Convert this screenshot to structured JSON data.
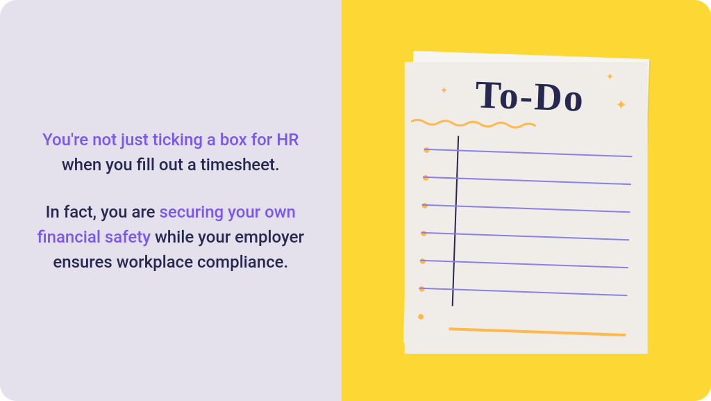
{
  "left": {
    "para1_highlight": "You're not just ticking a box for HR",
    "para1_rest": " when you fill out a timesheet.",
    "para2_start": "In fact, you are ",
    "para2_highlight": "securing your own financial safety",
    "para2_rest": " while your employer ensures workplace compliance."
  },
  "right": {
    "todo_title": "To-Do"
  }
}
